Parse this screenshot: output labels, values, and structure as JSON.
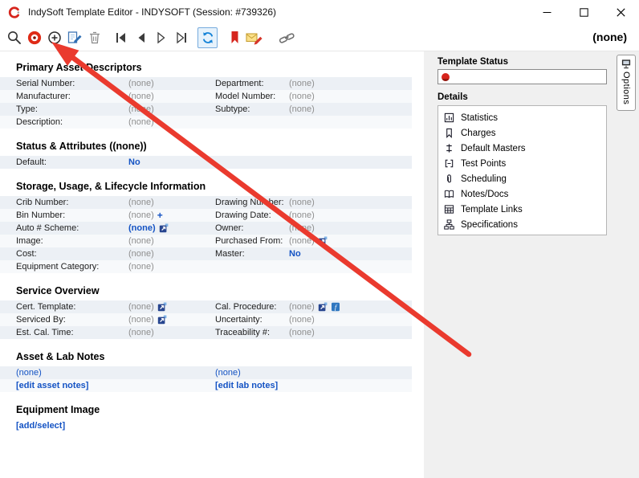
{
  "window": {
    "title": "IndySoft Template Editor - INDYSOFT (Session: #739326)"
  },
  "toolbar": {
    "record_indicator": "(none)",
    "icons": [
      "search",
      "record",
      "add",
      "edit",
      "delete",
      "first-record",
      "previous-record",
      "next-record",
      "last-record",
      "refresh",
      "bookmark",
      "mail-edit",
      "link"
    ]
  },
  "main": {
    "primary": {
      "title": "Primary Asset Descriptors",
      "rows": [
        {
          "l1": "Serial Number:",
          "v1": "(none)",
          "l2": "Department:",
          "v2": "(none)"
        },
        {
          "l1": "Manufacturer:",
          "v1": "(none)",
          "l2": "Model Number:",
          "v2": "(none)"
        },
        {
          "l1": "Type:",
          "v1": "(none)",
          "l2": "Subtype:",
          "v2": "(none)"
        },
        {
          "l1": "Description:",
          "v1": "(none)",
          "l2": "",
          "v2": ""
        }
      ]
    },
    "status": {
      "title": "Status & Attributes ((none))",
      "default_label": "Default:",
      "default_value": "No"
    },
    "storage": {
      "title": "Storage, Usage, & Lifecycle Information",
      "bin_plus": "+",
      "rows": [
        {
          "l1": "Crib Number:",
          "v1": "(none)",
          "l2": "Drawing Number:",
          "v2": "(none)"
        },
        {
          "l1": "Bin Number:",
          "v1": "(none)",
          "l2": "Drawing Date:",
          "v2": "(none)"
        },
        {
          "l1": "Auto # Scheme:",
          "v1": "(none)",
          "l2": "Owner:",
          "v2": "(none)"
        },
        {
          "l1": "Image:",
          "v1": "(none)",
          "l2": "Purchased From:",
          "v2": "(none)"
        },
        {
          "l1": "Cost:",
          "v1": "(none)",
          "l2": "Master:",
          "v2": "No"
        },
        {
          "l1": "Equipment Category:",
          "v1": "(none)",
          "l2": "",
          "v2": ""
        }
      ]
    },
    "service": {
      "title": "Service Overview",
      "rows": [
        {
          "l1": "Cert. Template:",
          "v1": "(none)",
          "l2": "Cal. Procedure:",
          "v2": "(none)"
        },
        {
          "l1": "Serviced By:",
          "v1": "(none)",
          "l2": "Uncertainty:",
          "v2": "(none)"
        },
        {
          "l1": "Est. Cal. Time:",
          "v1": "(none)",
          "l2": "Traceability #:",
          "v2": "(none)"
        }
      ]
    },
    "notes": {
      "title": "Asset & Lab Notes",
      "asset_value": "(none)",
      "lab_value": "(none)",
      "edit_asset_link": "[edit asset notes]",
      "edit_lab_link": "[edit lab notes]"
    },
    "image": {
      "title": "Equipment Image",
      "add_select_link": "[add/select]"
    }
  },
  "sidebar": {
    "template_status_label": "Template Status",
    "details_label": "Details",
    "items": [
      "Statistics",
      "Charges",
      "Default Masters",
      "Test Points",
      "Scheduling",
      "Notes/Docs",
      "Template Links",
      "Specifications"
    ],
    "options_tab_label": "Options"
  },
  "colors": {
    "link_blue": "#1453c4",
    "value_gray": "#8f8f8f",
    "row_stripe": "#ecf0f5",
    "arrow_red": "#ea3a2e",
    "bookmark_red": "#d6251d",
    "refresh_blue": "#1583d7"
  }
}
